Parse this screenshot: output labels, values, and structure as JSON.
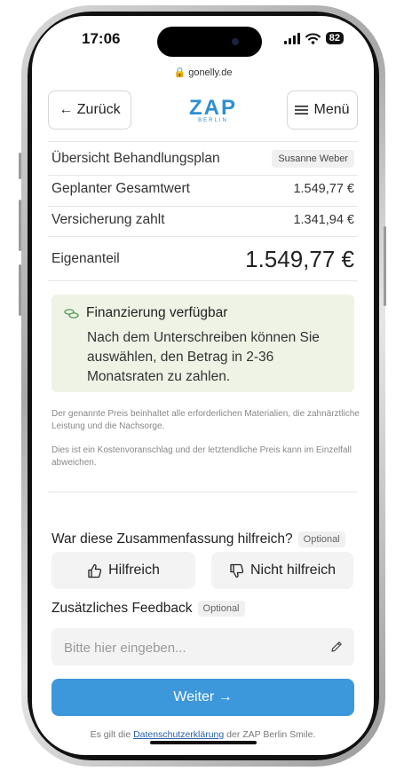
{
  "status_bar": {
    "time": "17:06",
    "battery": "82"
  },
  "browser": {
    "url": "gonelly.de"
  },
  "nav": {
    "back_label": "← Zurück",
    "logo": "ZAP",
    "logo_sub": "BERLIN",
    "menu_label": "Menü"
  },
  "plan": {
    "title": "Übersicht Behandlungsplan",
    "patient": "Susanne Weber",
    "rows": [
      {
        "label": "Geplanter Gesamtwert",
        "value": "1.549,77 €"
      },
      {
        "label": "Versicherung zahlt",
        "value": "1.341,94 €"
      }
    ],
    "own_share_label": "Eigenanteil",
    "own_share_value": "1.549,77 €"
  },
  "financing": {
    "title": "Finanzierung verfügbar",
    "text": "Nach dem Unterschreiben können Sie auswählen, den Betrag in 2-36 Monatsraten zu zahlen."
  },
  "notes": [
    "Der genannte Preis beinhaltet alle erforderlichen Materialien, die zahnärztliche Leistung und die Nachsorge.",
    "Dies ist ein Kostenvoranschlag und der letztendliche Preis kann im Einzelfall abweichen."
  ],
  "feedback": {
    "question": "War diese Zusammenfassung hilfreich?",
    "optional": "Optional",
    "helpful": "Hilfreich",
    "not_helpful": "Nicht hilfreich",
    "extra_label": "Zusätzliches Feedback",
    "extra_optional": "Optional",
    "placeholder": "Bitte hier eingeben..."
  },
  "cta": {
    "label": "Weiter →"
  },
  "legal": {
    "prefix": "Es gilt die",
    "link": "Datenschutzerklärung",
    "suffix": "der ZAP Berlin Smile."
  },
  "colors": {
    "accent": "#3d97db",
    "logo": "#2c8fd3",
    "info_bg": "#eef3e6"
  },
  "icons": [
    "lock-icon",
    "menu-icon",
    "coins-icon",
    "thumbs-up-icon",
    "thumbs-down-icon",
    "pencil-icon",
    "signal-icon",
    "wifi-icon",
    "battery-icon"
  ]
}
